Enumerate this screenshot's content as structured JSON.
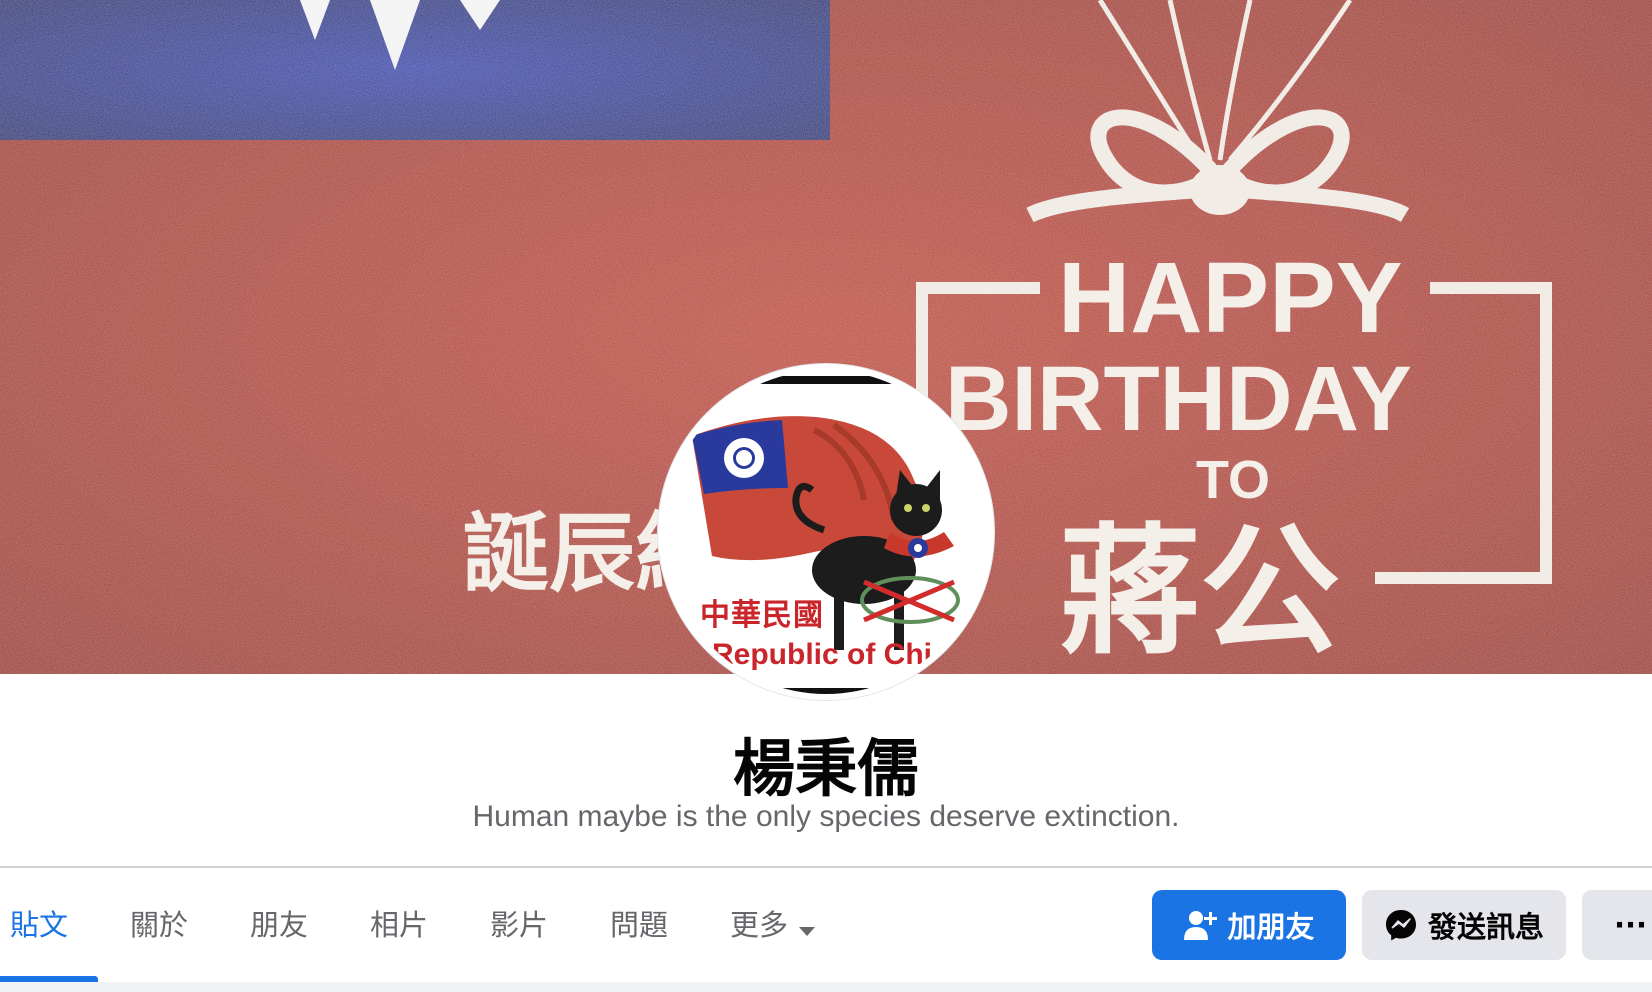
{
  "cover": {
    "text_happy": "HAPPY",
    "text_birthday": "BIRTHDAY",
    "text_to": "TO",
    "text_name": "蔣公",
    "text_left": "誕辰紀"
  },
  "avatar": {
    "text_cn": "中華民國",
    "text_en": "Republic of Chi"
  },
  "profile": {
    "name": "楊秉儒",
    "bio": "Human maybe is the only species deserve extinction."
  },
  "tabs": [
    {
      "label": "貼文",
      "active": true
    },
    {
      "label": "關於",
      "active": false
    },
    {
      "label": "朋友",
      "active": false
    },
    {
      "label": "相片",
      "active": false
    },
    {
      "label": "影片",
      "active": false
    },
    {
      "label": "問題",
      "active": false
    },
    {
      "label": "更多",
      "active": false
    }
  ],
  "actions": {
    "add_friend": "加朋友",
    "send_message": "發送訊息",
    "more": "···"
  },
  "colors": {
    "accent": "#1b74e4",
    "cover_red": "#b8402f",
    "flag_blue": "#2c3fa0"
  },
  "icons": {
    "add_friend": "add-friend-icon",
    "messenger": "messenger-icon",
    "more": "more-icon",
    "caret": "caret-down-icon"
  }
}
